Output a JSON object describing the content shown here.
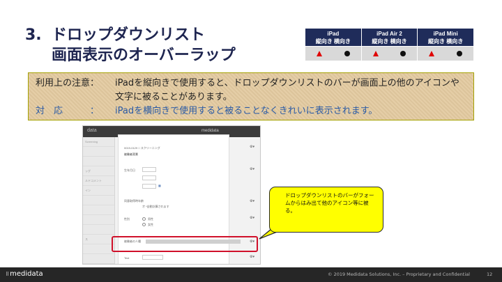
{
  "title": {
    "number": "3.",
    "line1": "ドロップダウンリスト",
    "line2": "画面表示のオーバーラップ"
  },
  "devices": [
    {
      "name": "iPad",
      "orientation": "縦向き 横向き",
      "portrait": "triangle",
      "landscape": "circle"
    },
    {
      "name": "iPad Air 2",
      "orientation": "縦向き 横向き",
      "portrait": "triangle",
      "landscape": "circle"
    },
    {
      "name": "iPad Mini",
      "orientation": "縦向き 横向き",
      "portrait": "triangle",
      "landscape": "circle"
    }
  ],
  "note": {
    "caution_label": "利用上の注意：",
    "caution_text": "iPadを縦向きで使用すると、ドロップダウンリストのバーが画面上の他のアイコンや文字に被ることがあります。",
    "response_label": "対　応　　　：",
    "response_text": "iPadを横向きで使用すると被ることなくきれいに表示されます。"
  },
  "screenshot": {
    "app_name": "data",
    "logo": "medidata",
    "sidebar_items": [
      "Screening",
      "",
      "",
      "ッグ",
      "ルドコメント",
      "イン",
      "",
      "",
      "",
      "",
      "ス",
      "",
      ""
    ],
    "form": {
      "header_id": "0019-0129  □ スクリーニング",
      "section": "被験者背景",
      "fields": [
        "生年月日",
        "同意取得時年齢",
        "性別",
        "被験者の人種",
        "Test"
      ],
      "age_note": "才  *自動計算されます",
      "sex_options": [
        "男性",
        "女性"
      ],
      "date_placeholders": [
        "YYYY",
        "MMM",
        "DD"
      ]
    }
  },
  "callout_text": "ドロップダウンリストのバーがフォームからはみ出て他のアイコン等に被る。",
  "footer": {
    "brand": "medidata",
    "copyright": "© 2019 Medidata Solutions, Inc. – Proprietary and Confidential",
    "page": "12"
  },
  "colors": {
    "title": "#1e2550",
    "table_header": "#1f2c5a",
    "note_bg": "#e3caa0",
    "answer_text": "#2a5aa5",
    "callout": "#ffff00",
    "highlight": "#d0102a"
  }
}
